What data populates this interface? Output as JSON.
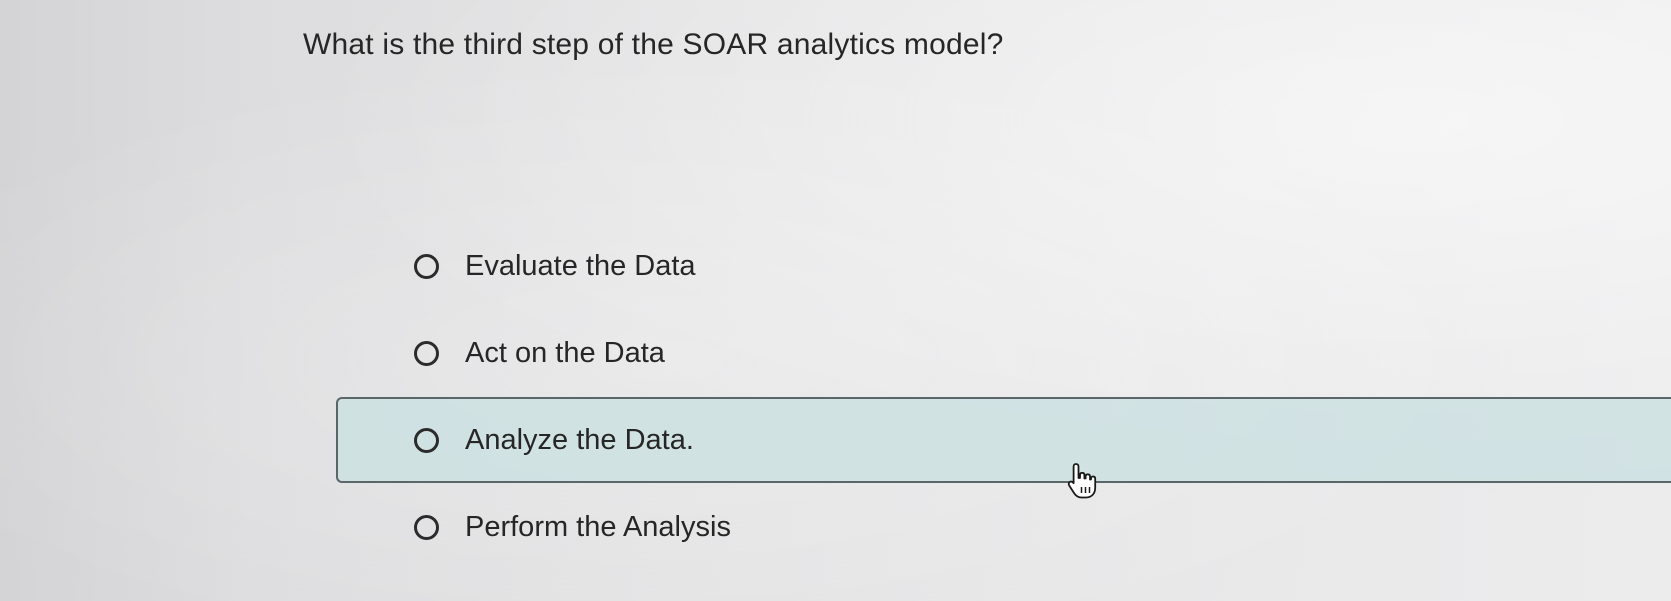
{
  "question": {
    "text": "What is the third step of the SOAR analytics model?"
  },
  "options": [
    {
      "label": "Evaluate the Data",
      "selected": false
    },
    {
      "label": "Act on the Data",
      "selected": false
    },
    {
      "label": "Analyze the Data.",
      "selected": false,
      "hovered": true
    },
    {
      "label": "Perform the Analysis",
      "selected": false
    }
  ],
  "cursor": {
    "icon": "hand-pointer-icon"
  },
  "colors": {
    "hover_background": "#cde0e2",
    "hover_border": "#5a6668",
    "text": "#262626"
  }
}
